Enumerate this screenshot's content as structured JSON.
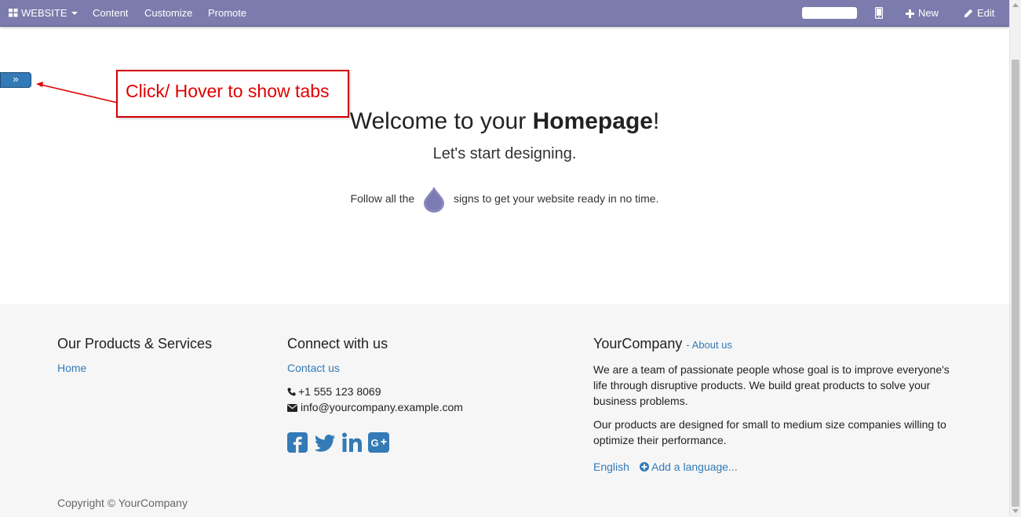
{
  "navbar": {
    "website_label": "WEBSITE",
    "content_label": "Content",
    "customize_label": "Customize",
    "promote_label": "Promote",
    "search_value": "",
    "new_label": "New",
    "edit_label": "Edit",
    "background_color": "#7c7bad"
  },
  "side_tab": {
    "toggle_glyph": "»"
  },
  "annotation": {
    "text": "Click/ Hover to show tabs",
    "color": "#e00000"
  },
  "hero": {
    "welcome_prefix": "Welcome to your ",
    "welcome_bold": "Homepage",
    "welcome_suffix": "!",
    "subtitle": "Let's start designing.",
    "follow_before": "Follow all the",
    "follow_after": "signs to get your website ready in no time."
  },
  "footer": {
    "products_title": "Our Products & Services",
    "home_link": "Home",
    "connect_title": "Connect with us",
    "contact_link": "Contact us",
    "phone": "+1 555 123 8069",
    "email": "info@yourcompany.example.com",
    "social_icons": [
      "facebook-icon",
      "twitter-icon",
      "linkedin-icon",
      "google-plus-icon"
    ],
    "company_title": "YourCompany",
    "about_link": "- About us",
    "company_p1": "We are a team of passionate people whose goal is to improve everyone's life through disruptive products. We build great products to solve your business problems.",
    "company_p2": "Our products are designed for small to medium size companies willing to optimize their performance.",
    "lang_current": "English",
    "lang_add": "Add a language...",
    "copyright": "Copyright © YourCompany",
    "link_color": "#337ab7"
  }
}
